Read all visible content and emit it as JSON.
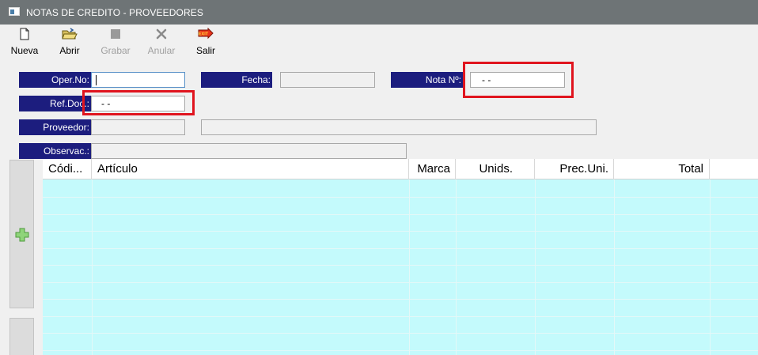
{
  "window": {
    "title": "NOTAS DE CREDITO - PROVEEDORES"
  },
  "toolbar": {
    "nueva": "Nueva",
    "abrir": "Abrir",
    "grabar": "Grabar",
    "anular": "Anular",
    "salir": "Salir",
    "exit_badge": "EXIT"
  },
  "form": {
    "oper_no": {
      "label": "Oper.No:",
      "value": ""
    },
    "fecha": {
      "label": "Fecha:",
      "value": ""
    },
    "nota_no": {
      "label": "Nota Nº:",
      "value": "- -"
    },
    "ref_doc": {
      "label": "Ref.Doc.:",
      "value": "- -"
    },
    "proveedor": {
      "label": "Proveedor:",
      "code": "",
      "name": ""
    },
    "observac": {
      "label": "Observac.:",
      "value": ""
    }
  },
  "grid": {
    "columns": [
      "Códi...",
      "Artículo",
      "Marca",
      "Unids.",
      "Prec.Uni.",
      "Total"
    ],
    "rows": []
  },
  "colors": {
    "label_bg": "#1c1d7e",
    "grid_bg": "#c4fafc",
    "highlight": "#e0141e",
    "titlebar": "#6e7476"
  }
}
